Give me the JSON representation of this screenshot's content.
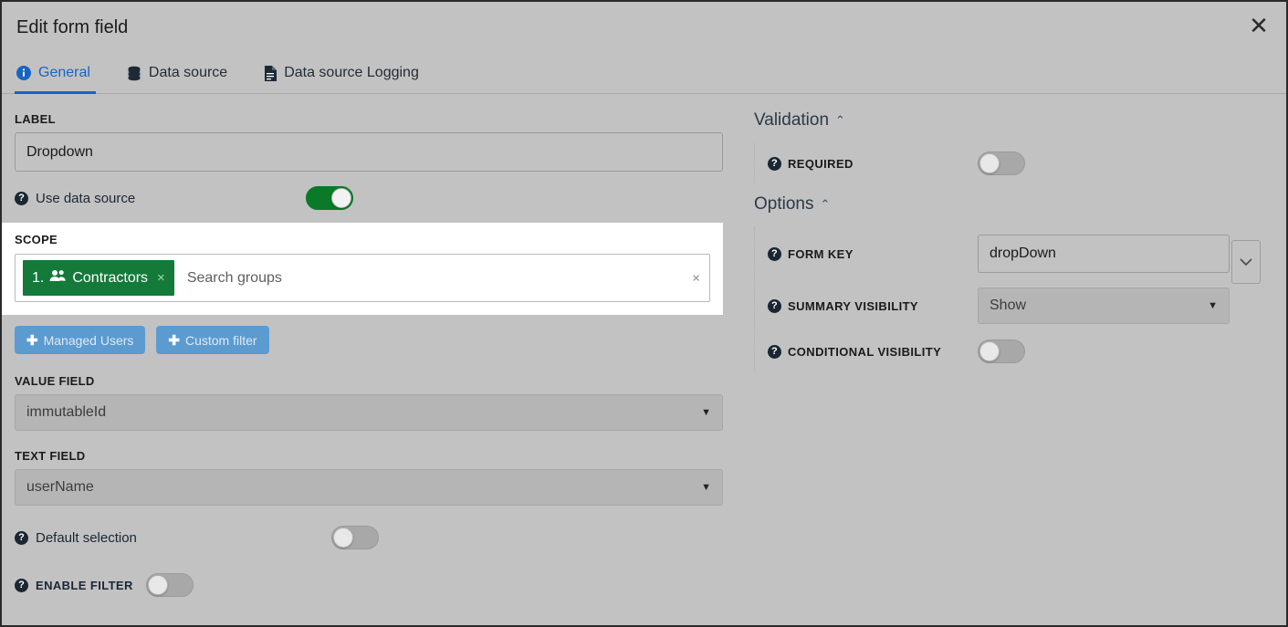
{
  "window": {
    "title": "Edit form field",
    "close_label": "✕"
  },
  "tabs": [
    {
      "label": "General",
      "icon": "info-circle-icon",
      "active": true
    },
    {
      "label": "Data source",
      "icon": "database-icon",
      "active": false
    },
    {
      "label": "Data source Logging",
      "icon": "file-document-icon",
      "active": false
    }
  ],
  "left": {
    "label_heading": "LABEL",
    "label_value": "Dropdown",
    "use_data_source": {
      "label": "Use data source",
      "state": "on"
    },
    "scope": {
      "heading": "SCOPE",
      "chip": {
        "index": "1.",
        "name": "Contractors",
        "remove": "×",
        "icon": "users-group-icon",
        "color": "#137a3a"
      },
      "placeholder": "Search groups",
      "clear": "×"
    },
    "buttons": [
      {
        "label": "Managed Users",
        "icon": "plus-icon"
      },
      {
        "label": "Custom filter",
        "icon": "plus-icon"
      }
    ],
    "value_field": {
      "heading": "VALUE FIELD",
      "value": "immutableId"
    },
    "text_field": {
      "heading": "TEXT FIELD",
      "value": "userName"
    },
    "default_selection": {
      "label": "Default selection",
      "state": "off"
    },
    "enable_filter": {
      "label": "ENABLE FILTER",
      "state": "off"
    }
  },
  "right": {
    "validation": {
      "title": "Validation",
      "chevron": "⌃",
      "required": {
        "label": "REQUIRED",
        "state": "off"
      },
      "expand_button": "⌄"
    },
    "options": {
      "title": "Options",
      "chevron": "⌃",
      "form_key": {
        "label": "FORM KEY",
        "value": "dropDown"
      },
      "summary_visibility": {
        "label": "SUMMARY VISIBILITY",
        "value": "Show",
        "caret": "▼"
      },
      "conditional_visibility": {
        "label": "CONDITIONAL VISIBILITY",
        "state": "off"
      }
    }
  },
  "colors": {
    "accent_blue": "#1765c0",
    "toggle_on_green": "#0a7a28",
    "chip_green": "#137a3a",
    "button_blue": "#5b9bd0",
    "background": "#c2c2c2"
  },
  "help_glyph": "?",
  "caret_down": "▼"
}
